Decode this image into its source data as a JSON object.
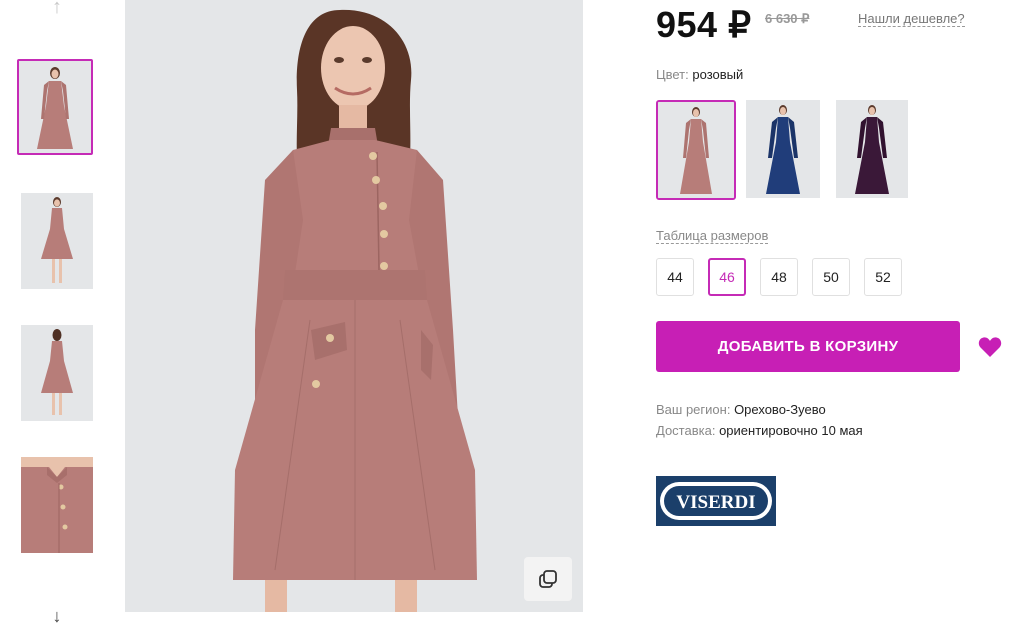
{
  "product": {
    "price": "954 ₽",
    "old_price": "6 630 ₽",
    "cheaper_link": "Нашли дешевле?",
    "color_label": "Цвет:",
    "color_value": "розовый",
    "swatches": [
      {
        "name": "розовый",
        "color": "#b77d79"
      },
      {
        "name": "синий",
        "color": "#203d7a"
      },
      {
        "name": "фиолетовый",
        "color": "#3a1838"
      }
    ],
    "size_table_link": "Таблица размеров",
    "sizes": [
      "44",
      "46",
      "48",
      "50",
      "52"
    ],
    "selected_size": "46",
    "add_to_cart": "ДОБАВИТЬ В КОРЗИНУ",
    "region_label": "Ваш регион:",
    "region_value": "Орехово-Зуево",
    "delivery_label": "Доставка:",
    "delivery_value": "ориентировочно 10 мая",
    "brand": "VISERDI"
  },
  "colors": {
    "accent": "#c71fb5",
    "dress_pink": "#b77d79",
    "brand_navy": "#1b3f6a"
  },
  "icons": {
    "thumbs_up": "arrow-up-icon",
    "thumbs_down": "arrow-down-icon",
    "zoom": "zoom-icon",
    "favorite": "heart-icon"
  }
}
